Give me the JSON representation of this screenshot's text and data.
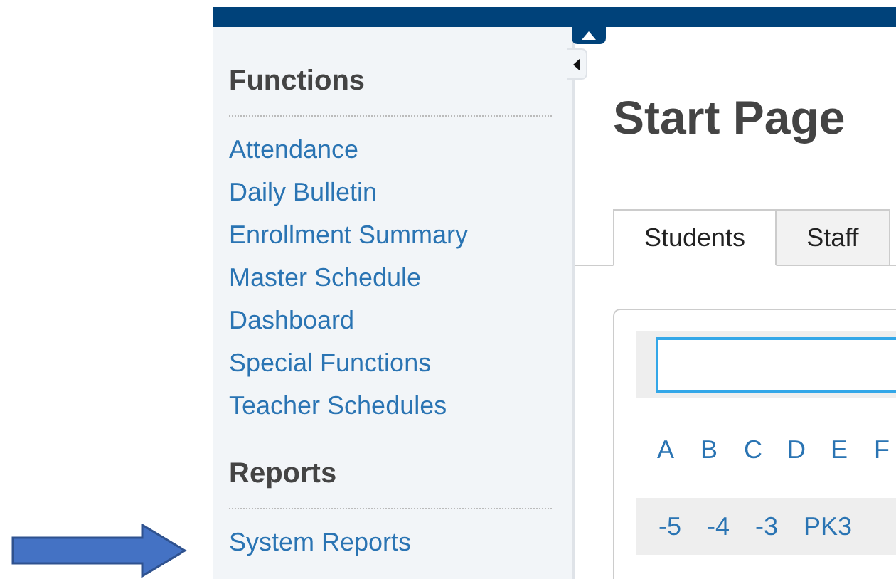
{
  "sidebar": {
    "sections": [
      {
        "heading": "Functions",
        "items": [
          "Attendance",
          "Daily Bulletin",
          "Enrollment Summary",
          "Master Schedule",
          "Dashboard",
          "Special Functions",
          "Teacher Schedules"
        ]
      },
      {
        "heading": "Reports",
        "items": [
          "System Reports"
        ]
      }
    ]
  },
  "main": {
    "title": "Start Page",
    "tabs": [
      {
        "label": "Students",
        "selected": true
      },
      {
        "label": "Staff",
        "selected": false
      }
    ],
    "search": {
      "focused": true
    },
    "letters": [
      "A",
      "B",
      "C",
      "D",
      "E",
      "F"
    ],
    "grades": [
      "-5",
      "-4",
      "-3",
      "PK3"
    ]
  }
}
